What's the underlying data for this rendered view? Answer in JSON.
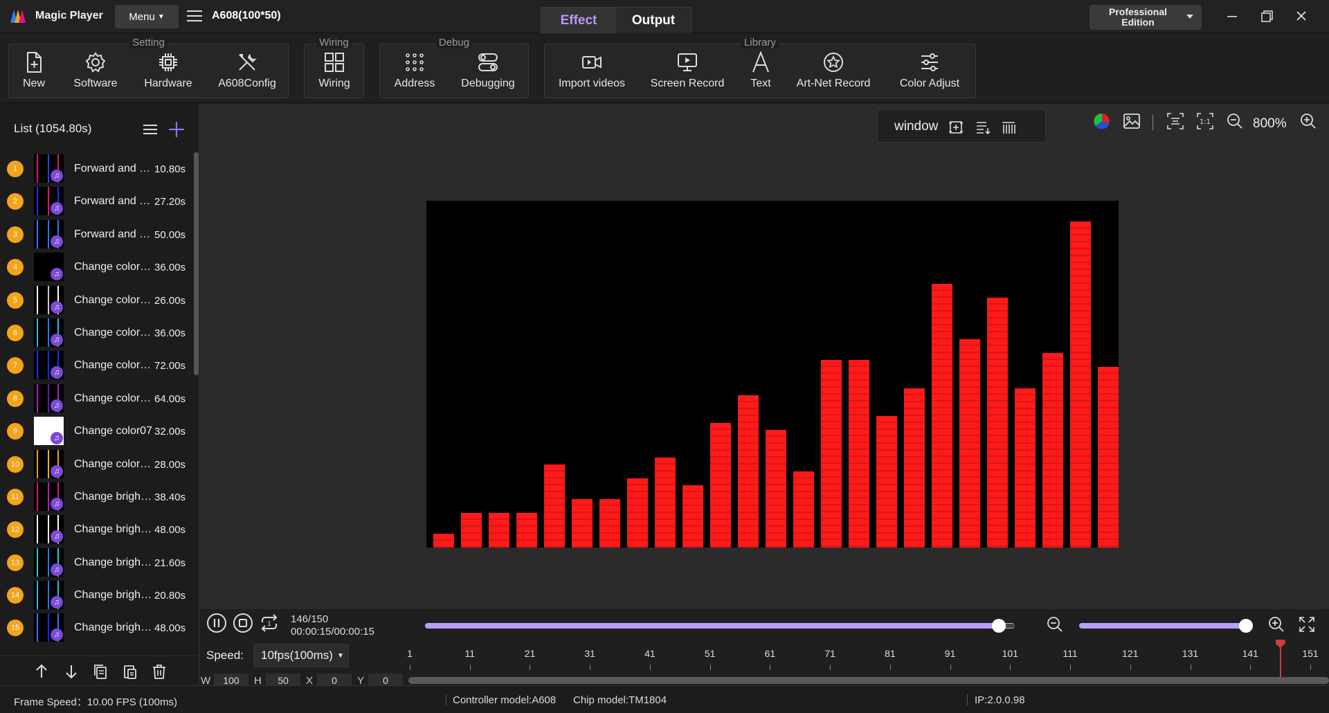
{
  "app": {
    "title": "Magic Player",
    "menu_label": "Menu",
    "project": "A608(100*50)"
  },
  "mode_tabs": [
    {
      "label": "Effect",
      "active": true
    },
    {
      "label": "Output",
      "active": false
    }
  ],
  "edition": {
    "line1": "Professional",
    "line2": "Edition"
  },
  "toolbar": {
    "groups": {
      "setting": "Setting",
      "wiring": "Wiring",
      "debug": "Debug",
      "library": "Library"
    },
    "tools": {
      "new": "New",
      "software": "Software",
      "hardware": "Hardware",
      "a608config": "A608Config",
      "wiring": "Wiring",
      "address": "Address",
      "debugging": "Debugging",
      "import_videos": "Import videos",
      "screen_record": "Screen Record",
      "text": "Text",
      "artnet_record": "Art-Net Record",
      "color_adjust": "Color Adjust"
    }
  },
  "list": {
    "title": "List (1054.80s)",
    "items": [
      {
        "num": "1",
        "name": "Forward and r…",
        "duration": "10.80s",
        "colors": [
          "#e0157a",
          "#2244ff"
        ]
      },
      {
        "num": "2",
        "name": "Forward and r…",
        "duration": "27.20s",
        "colors": [
          "#1a2bff",
          "#e0157a"
        ]
      },
      {
        "num": "3",
        "name": "Forward and r…",
        "duration": "50.00s",
        "colors": [
          "#1f7bff",
          "#1f7bff"
        ]
      },
      {
        "num": "4",
        "name": "Change color …",
        "duration": "36.00s",
        "colors": [
          "#000000",
          "#000000"
        ]
      },
      {
        "num": "5",
        "name": "Change color …",
        "duration": "26.00s",
        "colors": [
          "#ffffff",
          "#cccccc"
        ]
      },
      {
        "num": "6",
        "name": "Change color …",
        "duration": "36.00s",
        "colors": [
          "#17c3e8",
          "#1f7bff"
        ]
      },
      {
        "num": "7",
        "name": "Change color …",
        "duration": "72.00s",
        "colors": [
          "#1a2bff",
          "#1a2bff"
        ]
      },
      {
        "num": "8",
        "name": "Change color …",
        "duration": "64.00s",
        "colors": [
          "#b31fbf",
          "#6a1ba8"
        ]
      },
      {
        "num": "9",
        "name": "Change color07",
        "duration": "32.00s",
        "colors": [
          "#ffffff",
          "#ffffff"
        ]
      },
      {
        "num": "10",
        "name": "Change color …",
        "duration": "28.00s",
        "colors": [
          "#ff9a1a",
          "#ffb21a"
        ]
      },
      {
        "num": "11",
        "name": "Change brigh…",
        "duration": "38.40s",
        "colors": [
          "#e0157a",
          "#b31fbf"
        ]
      },
      {
        "num": "12",
        "name": "Change brigh…",
        "duration": "48.00s",
        "colors": [
          "#ffffff",
          "#eeeeee"
        ]
      },
      {
        "num": "13",
        "name": "Change brigh…",
        "duration": "21.60s",
        "colors": [
          "#17d8c8",
          "#1f7bff"
        ]
      },
      {
        "num": "14",
        "name": "Change brigh…",
        "duration": "20.80s",
        "colors": [
          "#17c3e8",
          "#1f7bff"
        ]
      },
      {
        "num": "15",
        "name": "Change brigh…",
        "duration": "48.00s",
        "colors": [
          "#1f7bff",
          "#1a2bff"
        ]
      }
    ]
  },
  "view": {
    "window_label": "window",
    "zoom": "800%"
  },
  "preview": {
    "bar_levels": [
      4,
      10,
      10,
      10,
      24,
      14,
      14,
      20,
      26,
      18,
      36,
      44,
      34,
      22,
      54,
      54,
      38,
      46,
      76,
      60,
      72,
      46,
      56,
      94,
      52
    ]
  },
  "playback": {
    "frame": "146/150",
    "time": "00:00:15/00:00:15",
    "seek_fraction": 0.973,
    "zoom_fraction": 0.96
  },
  "speed": {
    "label": "Speed:",
    "value": "10fps(100ms)"
  },
  "ruler": {
    "labels": [
      "1",
      "11",
      "21",
      "31",
      "41",
      "51",
      "61",
      "71",
      "81",
      "91",
      "101",
      "111",
      "121",
      "131",
      "141",
      "151"
    ],
    "playhead_frame": 146
  },
  "dims": {
    "w_label": "W",
    "w": "100",
    "h_label": "H",
    "h": "50",
    "x_label": "X",
    "x": "0",
    "y_label": "Y",
    "y": "0"
  },
  "status": {
    "frame_speed": "Frame Speed：10.00 FPS (100ms)",
    "controller": "Controller model:A608",
    "chip": "Chip model:TM1804",
    "ip": "IP:2.0.0.98"
  }
}
